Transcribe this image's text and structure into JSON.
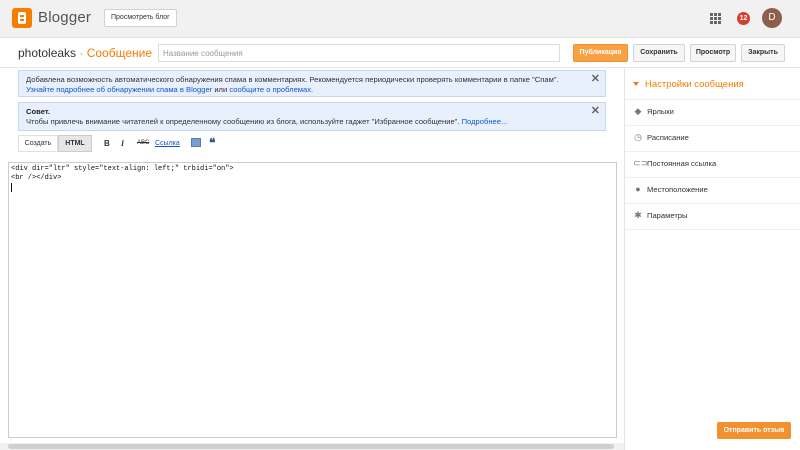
{
  "header": {
    "brand": "Blogger",
    "view_blog_label": "Просмотреть блог",
    "notification_count": "12",
    "avatar_initial": "D"
  },
  "editor": {
    "blog_name": "photoleaks",
    "separator": " · ",
    "section": "Сообщение",
    "title_placeholder": "Название сообщения",
    "title_value": "",
    "buttons": {
      "publish": "Публикация",
      "save": "Сохранить",
      "preview": "Просмотр",
      "close": "Закрыть"
    },
    "modes": {
      "compose": "Создать",
      "html": "HTML"
    },
    "toolbar": {
      "bold": "B",
      "italic": "I",
      "strike": "ABC",
      "link": "Ссылка",
      "quote": "❝"
    },
    "code_lines": [
      "<div dir=\"ltr\" style=\"text-align: left;\" trbidi=\"on\">",
      "<br /></div>"
    ]
  },
  "notices": [
    {
      "text_1": "Добавлена возможность автоматического обнаружения спама в комментариях. Рекомендуется периодически проверять комментарии в папке \"Спам\". ",
      "link_1": "Узнайте подробнее об обнаружении спама в Blogger",
      "text_2": " или ",
      "link_2": "сообщите о проблемах."
    },
    {
      "title": "Совет.",
      "text": "Чтобы привлечь внимание читателей к определенному сообщению из блога, используйте гаджет \"Избранное сообщение\". ",
      "link": "Подробнее..."
    }
  ],
  "sidebar": {
    "heading": "Настройки сообщения",
    "items": [
      {
        "label": "Ярлыки",
        "icon": "tag-icon"
      },
      {
        "label": "Расписание",
        "icon": "clock-icon"
      },
      {
        "label": "Постоянная ссылка",
        "icon": "link-icon"
      },
      {
        "label": "Местоположение",
        "icon": "location-pin-icon"
      },
      {
        "label": "Параметры",
        "icon": "gear-icon"
      }
    ]
  },
  "feedback_label": "Отправить отзыв",
  "colors": {
    "accent": "#f57d00",
    "publish": "#f9a144",
    "notice_bg": "#e8f0fe",
    "link": "#1155cc"
  }
}
